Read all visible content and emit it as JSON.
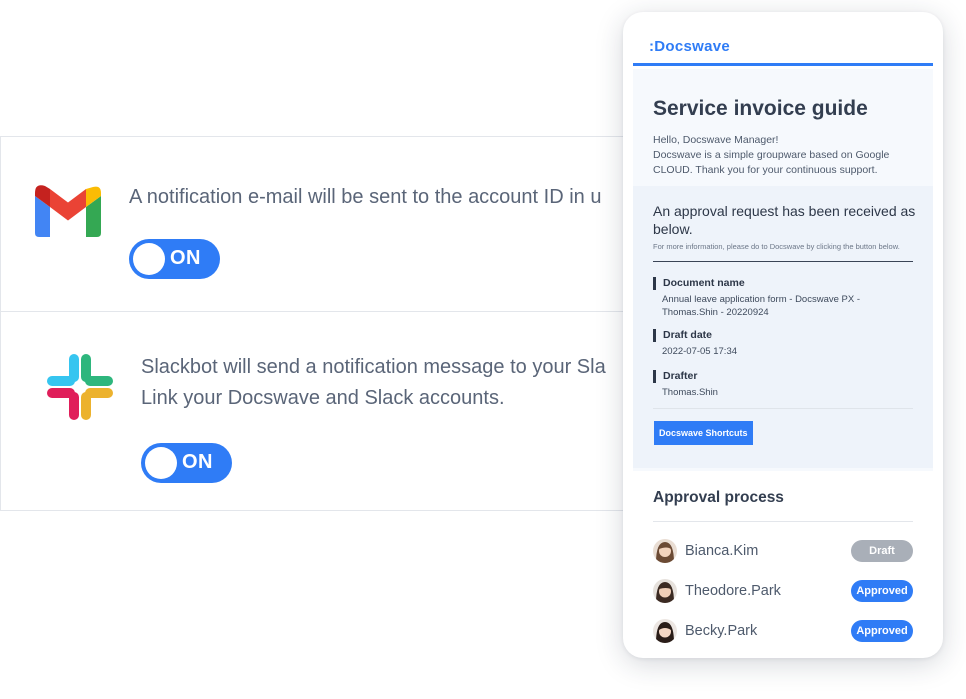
{
  "integrations": {
    "gmail": {
      "icon": "gmail-icon",
      "description": "A notification e-mail will be sent to the account ID in u",
      "toggle_label": "ON"
    },
    "slack": {
      "icon": "slack-icon",
      "description_line1": "Slackbot will send a notification message to your Sla",
      "description_line2": "Link your Docswave and Slack accounts.",
      "toggle_label": "ON"
    }
  },
  "mail": {
    "brand": ":Docswave",
    "title": "Service invoice guide",
    "greeting_line1": "Hello, Docswave Manager!",
    "greeting_line2": "Docswave is a simple groupware based on Google CLOUD.  Thank you for your continuous support.",
    "request_title": "An approval request has been received as below.",
    "request_note": "For more information, please do to Docswave by clicking the button below.",
    "fields": [
      {
        "label": "Document name",
        "value": "Annual leave application form - Docswave PX - Thomas.Shin - 20220924"
      },
      {
        "label": "Draft date",
        "value": "2022-07-05 17:34"
      },
      {
        "label": "Drafter",
        "value": "Thomas.Shin"
      }
    ],
    "shortcut_button": "Docswave Shortcuts",
    "process_title": "Approval process",
    "approvers": [
      {
        "name": "Bianca.Kim",
        "status": "Draft"
      },
      {
        "name": "Theodore.Park",
        "status": "Approved"
      },
      {
        "name": "Becky.Park",
        "status": "Approved"
      }
    ]
  },
  "colors": {
    "accent": "#2f7cf6",
    "draft_badge": "#a9afb8",
    "text": "#3e4a5c"
  }
}
